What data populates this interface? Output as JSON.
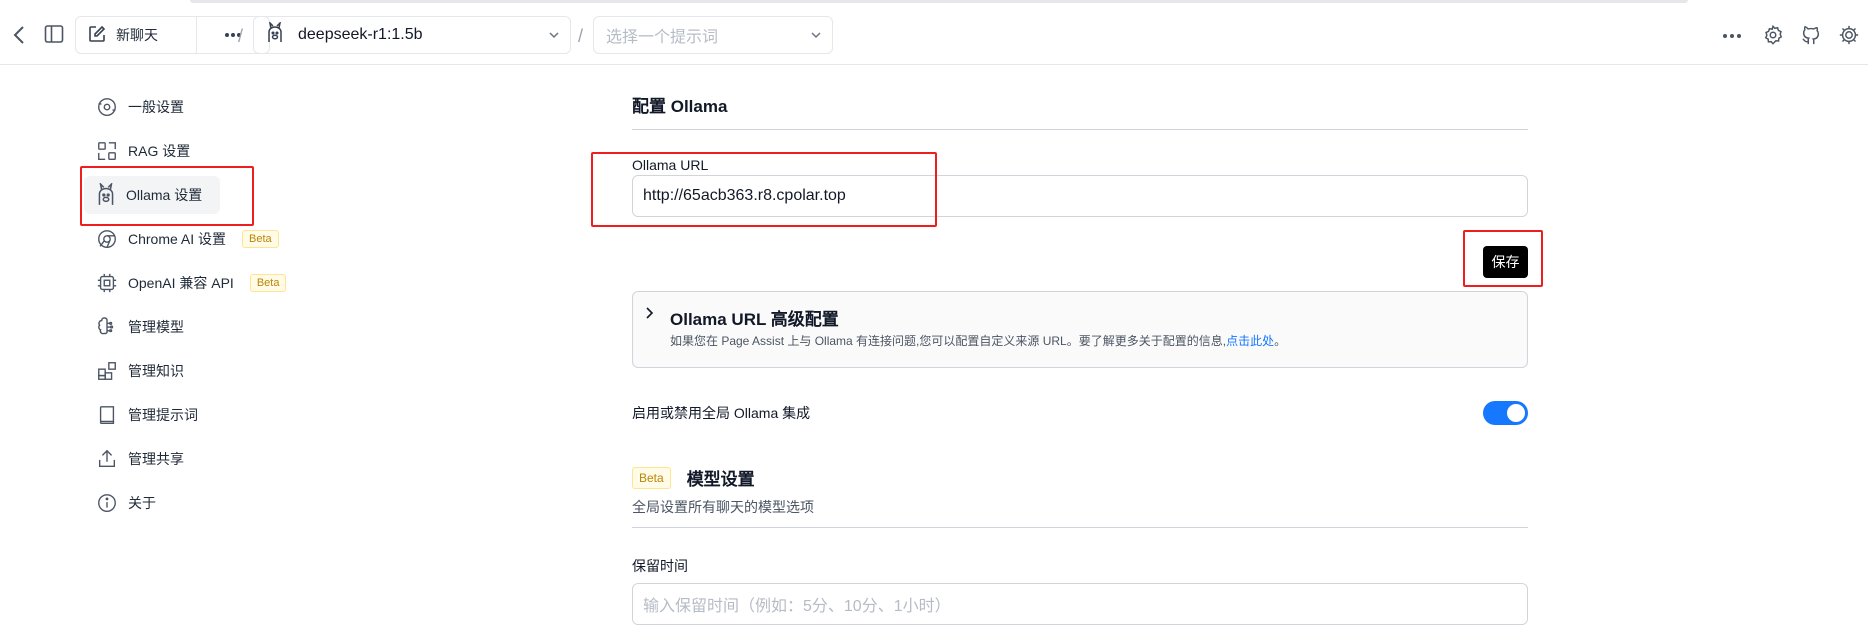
{
  "header": {
    "new_chat_label": "新聊天",
    "separator": "/",
    "model_value": "deepseek-r1:1.5b",
    "prompt_placeholder": "选择一个提示词"
  },
  "sidebar": {
    "items": [
      {
        "label": "一般设置",
        "icon": "settings-cog-icon"
      },
      {
        "label": "RAG 设置",
        "icon": "rag-grid-icon"
      },
      {
        "label": "Ollama 设置",
        "icon": "ollama-llama-icon"
      },
      {
        "label": "Chrome AI 设置",
        "icon": "chrome-icon",
        "badge": "Beta"
      },
      {
        "label": "OpenAI 兼容 API",
        "icon": "cpu-chip-icon",
        "badge": "Beta"
      },
      {
        "label": "管理模型",
        "icon": "brain-icon"
      },
      {
        "label": "管理知识",
        "icon": "blocks-icon"
      },
      {
        "label": "管理提示词",
        "icon": "book-icon"
      },
      {
        "label": "管理共享",
        "icon": "share-icon"
      },
      {
        "label": "关于",
        "icon": "info-icon"
      }
    ]
  },
  "main": {
    "section_title": "配置 Ollama",
    "url_label": "Ollama URL",
    "url_value": "http://65acb363.r8.cpolar.top",
    "save_label": "保存",
    "advanced": {
      "title": "Ollama URL 高级配置",
      "desc": "如果您在 Page Assist 上与 Ollama 有连接问题,您可以配置自定义来源 URL。要了解更多关于配置的信息,",
      "link": "点击此处",
      "end": "。"
    },
    "toggle_label": "启用或禁用全局 Ollama 集成",
    "toggle_on": true,
    "model_settings": {
      "badge": "Beta",
      "title": "模型设置",
      "subtitle": "全局设置所有聊天的模型选项"
    },
    "keep_alive_label": "保留时间",
    "keep_alive_placeholder": "输入保留时间（例如：5分、10分、1小时）"
  },
  "colors": {
    "accent": "#1677ff",
    "highlight": "#ef1e1e",
    "badge_text": "#b7860b"
  }
}
